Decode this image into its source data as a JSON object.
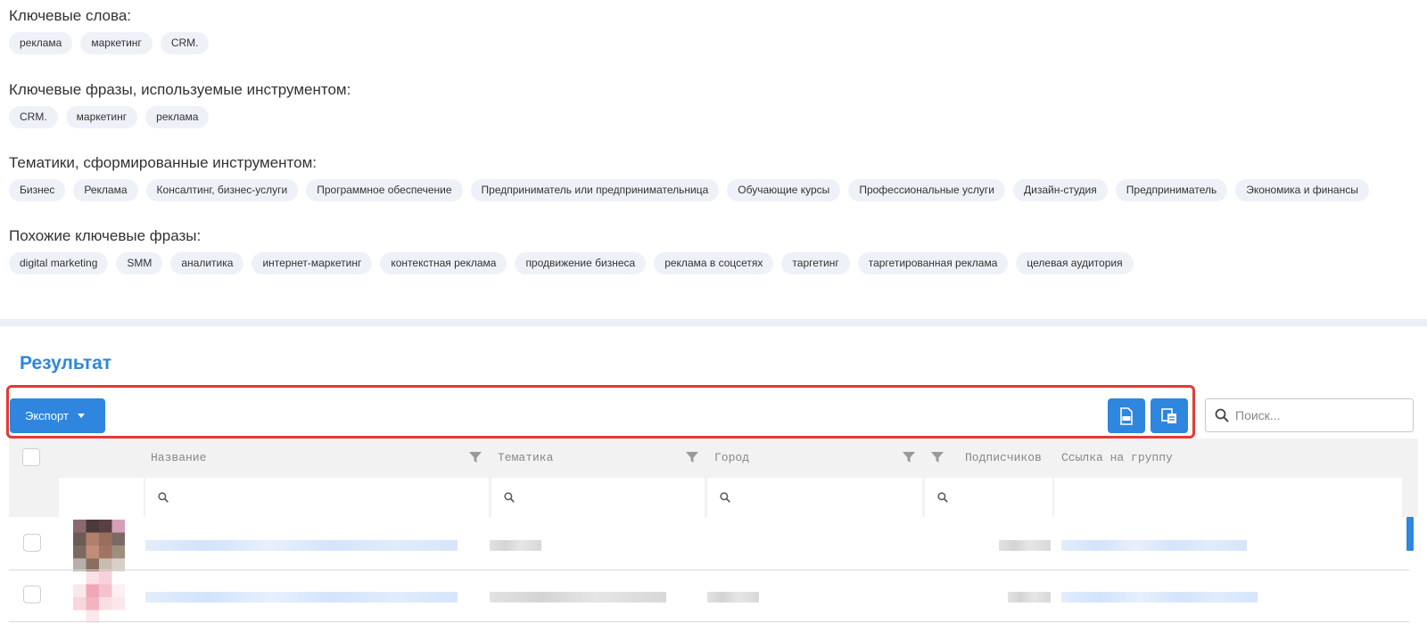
{
  "keyword_sections": [
    {
      "title": "Ключевые слова:",
      "chips": [
        "реклама",
        "маркетинг",
        "CRM."
      ]
    },
    {
      "title": "Ключевые фразы, используемые инструментом:",
      "chips": [
        "CRM.",
        "маркетинг",
        "реклама"
      ]
    },
    {
      "title": "Тематики, сформированные инструментом:",
      "chips": [
        "Бизнес",
        "Реклама",
        "Консалтинг, бизнес-услуги",
        "Программное обеспечение",
        "Предприниматель или предпринимательница",
        "Обучающие курсы",
        "Профессиональные услуги",
        "Дизайн-студия",
        "Предприниматель",
        "Экономика и финансы"
      ]
    },
    {
      "title": "Похожие ключевые фразы:",
      "chips": [
        "digital marketing",
        "SMM",
        "аналитика",
        "интернет-маркетинг",
        "контекстная реклама",
        "продвижение бизнеса",
        "реклама в соцсетях",
        "таргетинг",
        "таргетированная реклама",
        "целевая аудитория"
      ]
    }
  ],
  "result": {
    "title": "Результат",
    "export_label": "Экспорт",
    "search_placeholder": "Поиск..."
  },
  "table": {
    "columns": [
      "Название",
      "Тематика",
      "Город",
      "Подписчиков",
      "Ссылка на группу"
    ]
  },
  "colors": {
    "accent": "#2e86de",
    "highlight_frame": "#e53935",
    "chip_bg": "#eef2f8"
  },
  "icons": {
    "export_caret": "caret-down-icon",
    "xls_button": "xls-file-icon",
    "copy_button": "copy-columns-icon",
    "search": "search-icon",
    "filter": "funnel-icon"
  }
}
